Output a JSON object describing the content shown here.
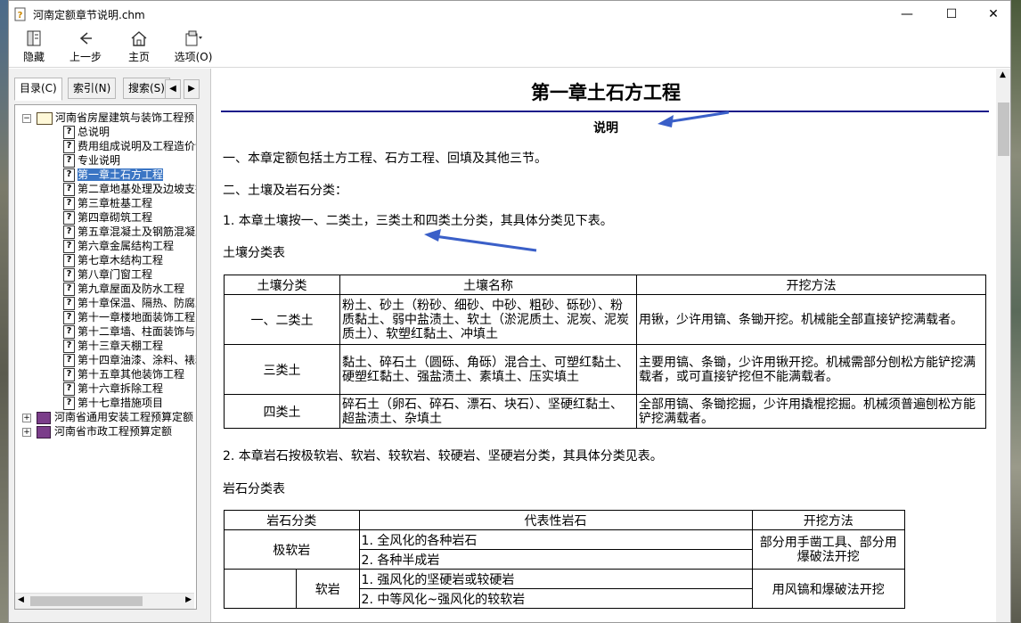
{
  "window": {
    "title": "河南定额章节说明.chm",
    "minimize": "—",
    "maximize": "☐",
    "close": "✕"
  },
  "toolbar": {
    "hide": "隐藏",
    "back": "上一步",
    "home": "主页",
    "options": "选项(O)"
  },
  "tabs": [
    "目录(C)",
    "索引(N)",
    "搜索(S)"
  ],
  "tree": {
    "root": "河南省房屋建筑与装饰工程预",
    "children": [
      "总说明",
      "费用组成说明及工程造价计",
      "专业说明",
      "第一章土石方工程",
      "第二章地基处理及边坡支打",
      "第三章桩基工程",
      "第四章砌筑工程",
      "第五章混凝土及钢筋混凝土",
      "第六章金属结构工程",
      "第七章木结构工程",
      "第八章门窗工程",
      "第九章屋面及防水工程",
      "第十章保温、隔热、防腐工",
      "第十一章楼地面装饰工程",
      "第十二章墙、柱面装饰与隔",
      "第十三章天棚工程",
      "第十四章油漆、涂料、裱糊",
      "第十五章其他装饰工程",
      "第十六章拆除工程",
      "第十七章措施项目"
    ],
    "others": [
      "河南省通用安装工程预算定额",
      "河南省市政工程预算定额"
    ]
  },
  "doc": {
    "title": "第一章土石方工程",
    "subtitle": "说明",
    "p1": "一、本章定额包括土方工程、石方工程、回填及其他三节。",
    "p2": "二、土壤及岩石分类：",
    "p3": "1. 本章土壤按一、二类土，三类土和四类土分类，其具体分类见下表。",
    "soil_caption": "土壤分类表",
    "soil_headers": [
      "土壤分类",
      "土壤名称",
      "开挖方法"
    ],
    "soil_rows": [
      [
        "一、二类土",
        "粉土、砂土（粉砂、细砂、中砂、粗砂、砾砂）、粉质黏土、弱中盐渍土、软土（淤泥质土、泥炭、泥炭质土）、软塑红黏土、冲填土",
        "用锹，少许用镐、条锄开挖。机械能全部直接铲挖满载者。"
      ],
      [
        "三类土",
        "黏土、碎石土（圆砾、角砾）混合土、可塑红黏土、硬塑红黏土、强盐渍土、素填土、压实填土",
        "主要用镐、条锄，少许用锹开挖。机械需部分刨松方能铲挖满载者，或可直接铲挖但不能满载者。"
      ],
      [
        "四类土",
        "碎石土（卵石、碎石、漂石、块石）、坚硬红黏土、超盐渍土、杂填土",
        "全部用镐、条锄挖掘，少许用撬棍挖掘。机械须普遍刨松方能铲挖满载者。"
      ]
    ],
    "p4": "2. 本章岩石按极软岩、软岩、较软岩、较硬岩、坚硬岩分类，其具体分类见表。",
    "rock_caption": "岩石分类表",
    "rock_headers": [
      "岩石分类",
      "代表性岩石",
      "开挖方法"
    ],
    "rock_very_soft": "极软岩",
    "rock_very_soft_items": [
      "1. 全风化的各种岩石",
      "2. 各种半成岩"
    ],
    "rock_very_soft_method": "部分用手凿工具、部分用爆破法开挖",
    "rock_soft": "软岩",
    "rock_soft_items": [
      "1. 强风化的坚硬岩或较硬岩",
      "2. 中等风化~强风化的较软岩"
    ],
    "rock_soft_method": "用风镐和爆破法开挖"
  },
  "colors": {
    "selection": "#3a75c4",
    "rule": "#1a1a8a",
    "arrow": "#3a5fc8"
  }
}
